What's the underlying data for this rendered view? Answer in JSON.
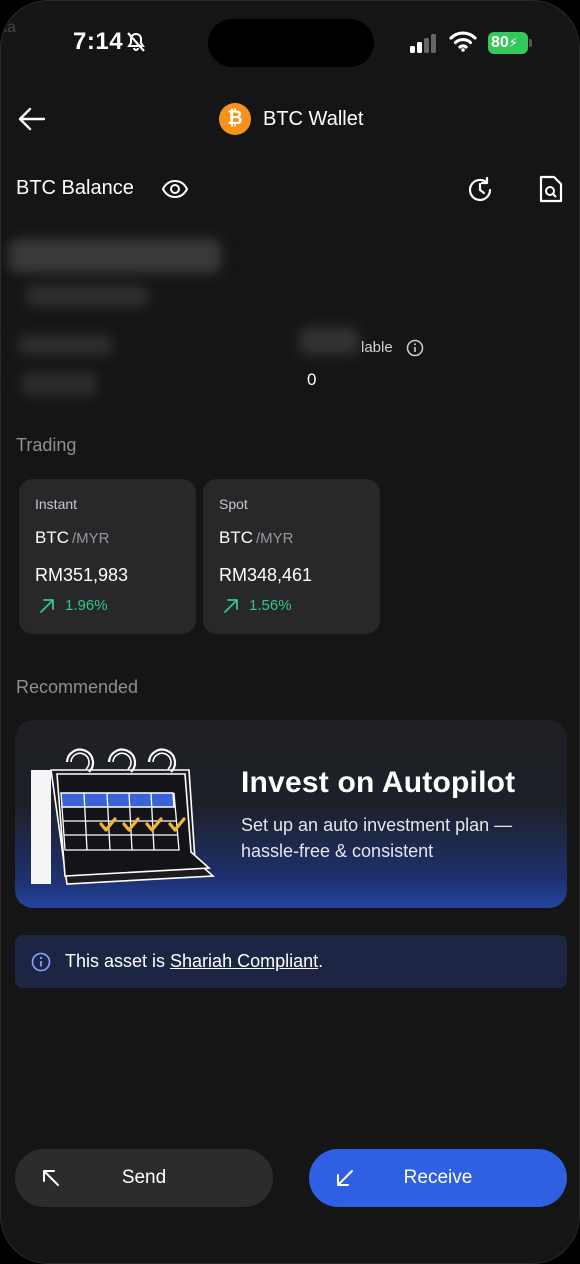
{
  "status_bar": {
    "time": "7:14",
    "battery": "80"
  },
  "header": {
    "title": "BTC Wallet",
    "coin_symbol": "₿",
    "coin_color": "#f7931a"
  },
  "balance": {
    "label": "BTC Balance",
    "available_label": "lable",
    "available_value": "0"
  },
  "trading": {
    "label": "Trading",
    "cards": [
      {
        "type": "Instant",
        "base": "BTC",
        "quote": "/MYR",
        "price": "RM351,983",
        "change": "1.96%"
      },
      {
        "type": "Spot",
        "base": "BTC",
        "quote": "/MYR",
        "price": "RM348,461",
        "change": "1.56%"
      }
    ]
  },
  "recommended": {
    "label": "Recommended",
    "banner_title": "Invest on Autopilot",
    "banner_subtitle": "Set up an auto investment plan — hassle-free & consistent"
  },
  "notice": {
    "prefix": "This asset is ",
    "link": "Shariah Compliant",
    "suffix": "."
  },
  "actions": {
    "send": "Send",
    "receive": "Receive"
  },
  "colors": {
    "accent": "#2f5fe3",
    "positive": "#34c787",
    "background": "#151516"
  }
}
